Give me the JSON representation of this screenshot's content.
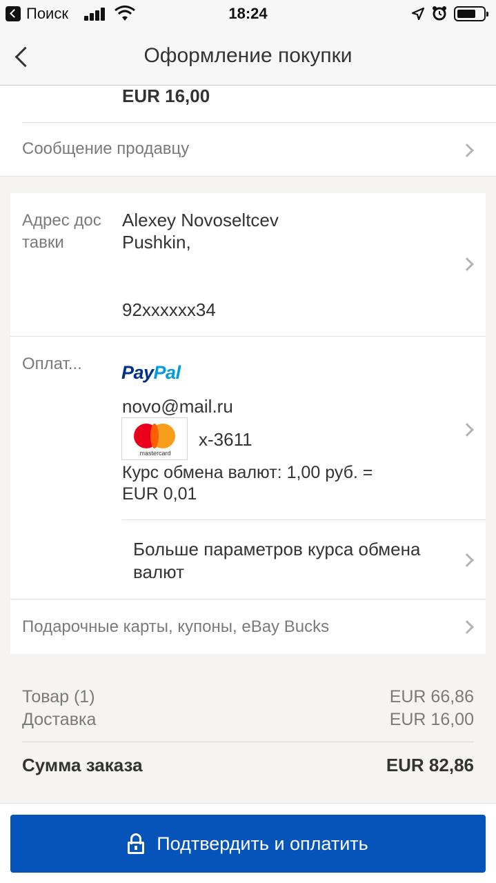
{
  "status_bar": {
    "carrier": "Поиск",
    "time": "18:24"
  },
  "nav": {
    "title": "Оформление покупки"
  },
  "top": {
    "shipping_price": "EUR 16,00",
    "message_seller": "Сообщение продавцу"
  },
  "address": {
    "label": "Адрес доставки",
    "name": "Alexey Novoseltcev",
    "city": "Pushkin,",
    "phone": "92xxxxxx34"
  },
  "payment": {
    "label": "Оплат...",
    "provider_part1": "Pay",
    "provider_part2": "Pal",
    "email": "novo@mail.ru",
    "card_brand": "mastercard",
    "card_number": "x-3611",
    "exchange_rate": "Курс обмена валют: 1,00 руб. = EUR 0,01",
    "more_rate_options": "Больше параметров курса обмена валют"
  },
  "gift": {
    "label": "Подарочные карты, купоны, eBay Bucks"
  },
  "totals": {
    "item_label": "Товар (1)",
    "item_value": "EUR 66,86",
    "shipping_label": "Доставка",
    "shipping_value": "EUR 16,00",
    "sum_label": "Сумма заказа",
    "sum_value": "EUR 82,86"
  },
  "confirm_button": {
    "label": "Подтвердить и оплатить"
  },
  "colors": {
    "primary_button": "#0654ba",
    "paypal_dark": "#003087",
    "paypal_light": "#009cde",
    "mastercard_red": "#eb001b",
    "mastercard_yellow": "#f79e1b"
  }
}
